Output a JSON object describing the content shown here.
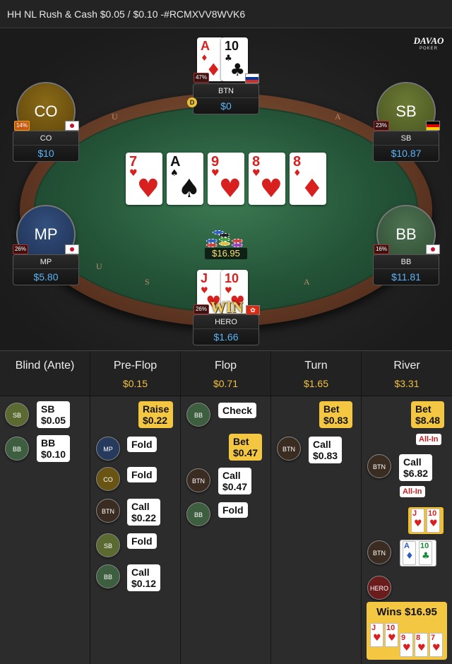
{
  "title": "HH NL Rush & Cash $0.05 / $0.10 -#RCMXVV8WVK6",
  "logo": {
    "line1": "DAVAO",
    "line2": "POKER"
  },
  "rail_letters": [
    "U",
    "S",
    "A",
    "U",
    "S",
    "A"
  ],
  "board": [
    {
      "rank": "7",
      "suit": "♥",
      "color": "red"
    },
    {
      "rank": "A",
      "suit": "♠",
      "color": "blk"
    },
    {
      "rank": "9",
      "suit": "♥",
      "color": "red"
    },
    {
      "rank": "8",
      "suit": "♥",
      "color": "red"
    },
    {
      "rank": "8",
      "suit": "♦",
      "color": "red"
    }
  ],
  "pot": "$16.95",
  "win_text": "WIN",
  "seats": {
    "btn": {
      "avatar": "",
      "name": "BTN",
      "stack": "$0",
      "equity": "47%",
      "flag": "ru",
      "dealer": "D",
      "cards": [
        {
          "rank": "A",
          "suit": "♦",
          "color": "red"
        },
        {
          "rank": "10",
          "suit": "♣",
          "color": "blk"
        }
      ]
    },
    "co": {
      "avatar": "CO",
      "name": "CO",
      "stack": "$10",
      "equity": "14%",
      "flag": "jp"
    },
    "sb": {
      "avatar": "SB",
      "name": "SB",
      "stack": "$10.87",
      "equity": "23%",
      "flag": "de"
    },
    "mp": {
      "avatar": "MP",
      "name": "MP",
      "stack": "$5.80",
      "equity": "26%",
      "flag": "jp"
    },
    "bb": {
      "avatar": "BB",
      "name": "BB",
      "stack": "$11.81",
      "equity": "16%",
      "flag": "jp"
    },
    "hero": {
      "name": "HERO",
      "stack": "$1.66",
      "equity": "26%",
      "flag": "hk",
      "cards": [
        {
          "rank": "J",
          "suit": "♥",
          "color": "red"
        },
        {
          "rank": "10",
          "suit": "♥",
          "color": "red"
        }
      ]
    }
  },
  "history": {
    "columns": [
      {
        "street": "Blind (Ante)",
        "pot": ""
      },
      {
        "street": "Pre-Flop",
        "pot": "$0.15"
      },
      {
        "street": "Flop",
        "pot": "$0.71"
      },
      {
        "street": "Turn",
        "pot": "$1.65"
      },
      {
        "street": "River",
        "pot": "$3.31"
      }
    ],
    "blind": [
      {
        "pos": "SB",
        "action": "SB",
        "amount": "$0.05"
      },
      {
        "pos": "BB",
        "action": "BB",
        "amount": "$0.10"
      }
    ],
    "preflop": [
      {
        "pos": "",
        "action": "Raise",
        "amount": "$0.22"
      },
      {
        "pos": "MP",
        "action": "Fold",
        "amount": ""
      },
      {
        "pos": "CO",
        "action": "Fold",
        "amount": ""
      },
      {
        "pos": "BTN",
        "action": "Call",
        "amount": "$0.22"
      },
      {
        "pos": "SB",
        "action": "Fold",
        "amount": ""
      },
      {
        "pos": "BB",
        "action": "Call",
        "amount": "$0.12"
      }
    ],
    "flop": [
      {
        "pos": "BB",
        "action": "Check",
        "amount": ""
      },
      {
        "pos": "",
        "action": "Bet",
        "amount": "$0.47"
      },
      {
        "pos": "BTN",
        "action": "Call",
        "amount": "$0.47"
      },
      {
        "pos": "BB",
        "action": "Fold",
        "amount": ""
      }
    ],
    "turn": [
      {
        "pos": "",
        "action": "Bet",
        "amount": "$0.83"
      },
      {
        "pos": "BTN",
        "action": "Call",
        "amount": "$0.83"
      }
    ],
    "river": {
      "bet": {
        "action": "Bet",
        "amount": "$8.48",
        "tag": "All-In"
      },
      "call": {
        "pos": "BTN",
        "action": "Call",
        "amount": "$6.82",
        "tag": "All-In"
      },
      "hero_show": [
        {
          "rank": "J",
          "suit": "♥",
          "color": "red"
        },
        {
          "rank": "10",
          "suit": "♥",
          "color": "red"
        }
      ],
      "btn_show": {
        "pos": "BTN",
        "cards": [
          {
            "rank": "A",
            "suit": "♦",
            "color": "blue"
          },
          {
            "rank": "10",
            "suit": "♣",
            "color": "green"
          }
        ]
      },
      "winner": {
        "pos": "HERO",
        "text": "Wins $16.95",
        "cards": [
          {
            "rank": "J",
            "suit": "♥",
            "color": "red"
          },
          {
            "rank": "10",
            "suit": "♥",
            "color": "red"
          },
          {
            "rank": "9",
            "suit": "♥",
            "color": "red"
          },
          {
            "rank": "8",
            "suit": "♥",
            "color": "red"
          },
          {
            "rank": "7",
            "suit": "♥",
            "color": "red"
          }
        ]
      }
    }
  },
  "colors": {
    "stack": "#5bb4f5",
    "pot": "#f2c040",
    "bet_bubble": "#f4c742",
    "felt": "#245438",
    "win": "#f0d060"
  }
}
